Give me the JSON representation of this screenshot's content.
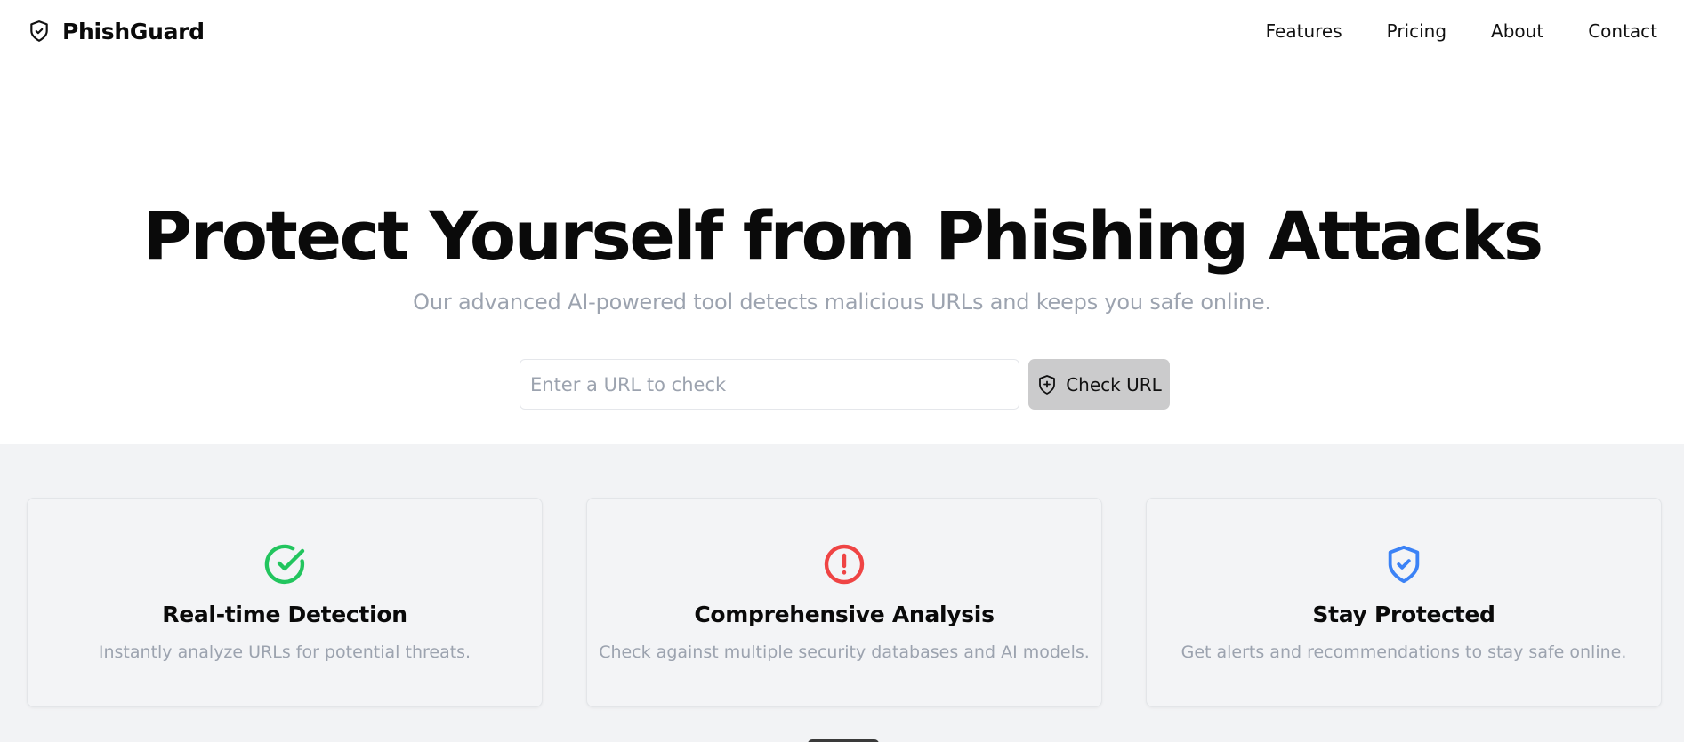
{
  "app": {
    "brand_name": "PhishGuard",
    "brand_icon": "shield-check-icon"
  },
  "nav": {
    "items": [
      {
        "label": "Features"
      },
      {
        "label": "Pricing"
      },
      {
        "label": "About"
      },
      {
        "label": "Contact"
      }
    ]
  },
  "hero": {
    "title": "Protect Yourself from Phishing Attacks",
    "subtitle": "Our advanced AI-powered tool detects malicious URLs and keeps you safe online.",
    "input": {
      "placeholder": "Enter a URL to check",
      "value": ""
    },
    "check_button": {
      "label": "Check URL",
      "icon": "shield-plus-icon"
    }
  },
  "features": {
    "cards": [
      {
        "icon": "check-circle-icon",
        "icon_color": "#22c55e",
        "title": "Real-time Detection",
        "description": "Instantly analyze URLs for potential threats."
      },
      {
        "icon": "alert-circle-icon",
        "icon_color": "#ef4444",
        "title": "Comprehensive Analysis",
        "description": "Check against multiple security databases and AI models."
      },
      {
        "icon": "shield-check-icon",
        "icon_color": "#3b82f6",
        "title": "Stay Protected",
        "description": "Get alerts and recommendations to stay safe online."
      }
    ]
  },
  "colors": {
    "text_primary": "#0a0a0a",
    "text_muted": "#9ca3af",
    "section_bg": "#f2f3f5",
    "button_bg": "#cbcbcc"
  }
}
